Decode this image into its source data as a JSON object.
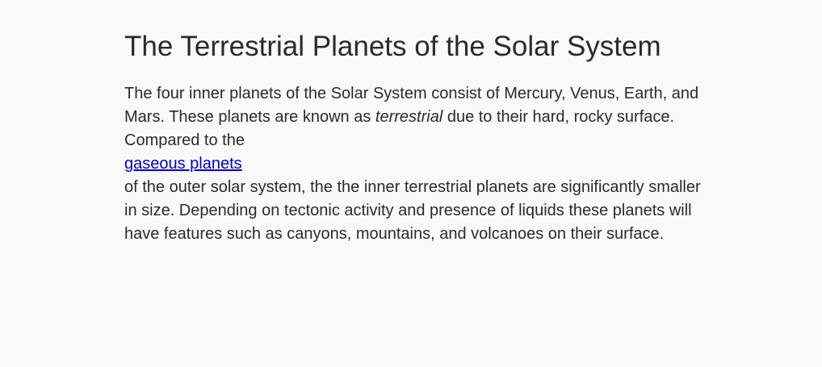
{
  "page": {
    "title": "The Terrestrial Planets of the Solar System"
  },
  "body": {
    "text_part1": "The four inner planets of the Solar System consist of Mercury, Venus, Earth, and Mars. These planets are known as ",
    "emphasis": "terrestrial",
    "text_part2": " due to their hard, rocky surface. Compared to the",
    "link_label": "gaseous planets",
    "text_part3": "of the outer solar system, the the inner terrestrial planets are significantly smaller in size. Depending on tectonic activity and presence of liquids these planets will have features such as canyons, mountains, and volcanoes on their surface."
  }
}
